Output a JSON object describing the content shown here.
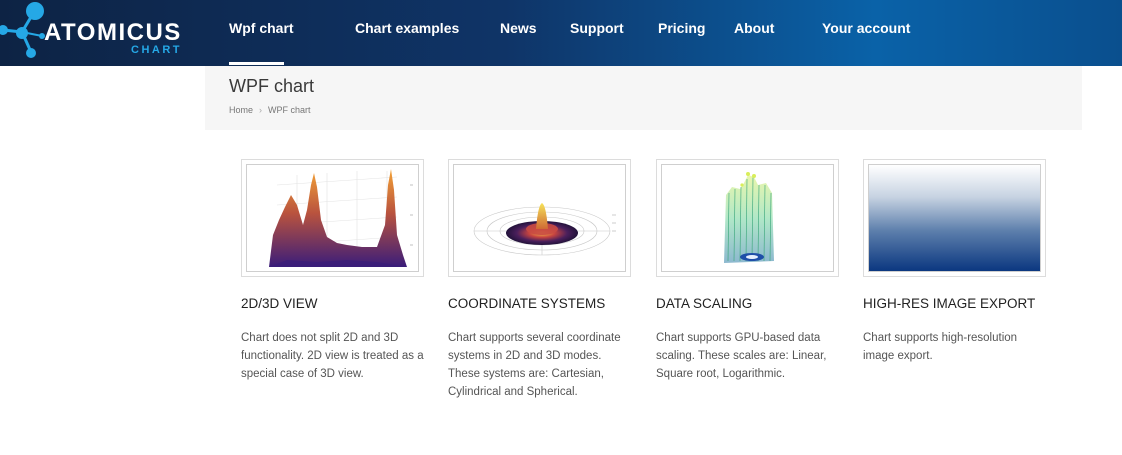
{
  "brand": {
    "name": "ATOMICUS",
    "sub": "CHART"
  },
  "nav": {
    "items": [
      {
        "label": "Wpf chart",
        "active": true
      },
      {
        "label": "Chart examples"
      },
      {
        "label": "News"
      },
      {
        "label": "Support"
      },
      {
        "label": "Pricing"
      },
      {
        "label": "About"
      },
      {
        "label": "Your account"
      }
    ]
  },
  "page": {
    "title": "WPF chart",
    "breadcrumb": {
      "home": "Home",
      "separator": "›",
      "current": "WPF chart"
    }
  },
  "features": [
    {
      "title": "2D/3D VIEW",
      "description": "Chart does not split 2D and 3D functionality. 2D view is treated as a special case of 3D view."
    },
    {
      "title": "COORDINATE SYSTEMS",
      "description": "Chart supports several coordinate systems in 2D and 3D modes. These systems are: Cartesian, Cylindrical and Spherical."
    },
    {
      "title": "DATA SCALING",
      "description": "Chart supports GPU-based data scaling. These scales are: Linear, Square root, Logarithmic."
    },
    {
      "title": "HIGH-RES IMAGE EXPORT",
      "description": "Chart supports high-resolution image export."
    }
  ],
  "colors": {
    "header_start": "#0d2344",
    "header_end": "#0a62a8",
    "brand_accent": "#25a8e6",
    "title_bar_bg": "#f6f6f6"
  }
}
